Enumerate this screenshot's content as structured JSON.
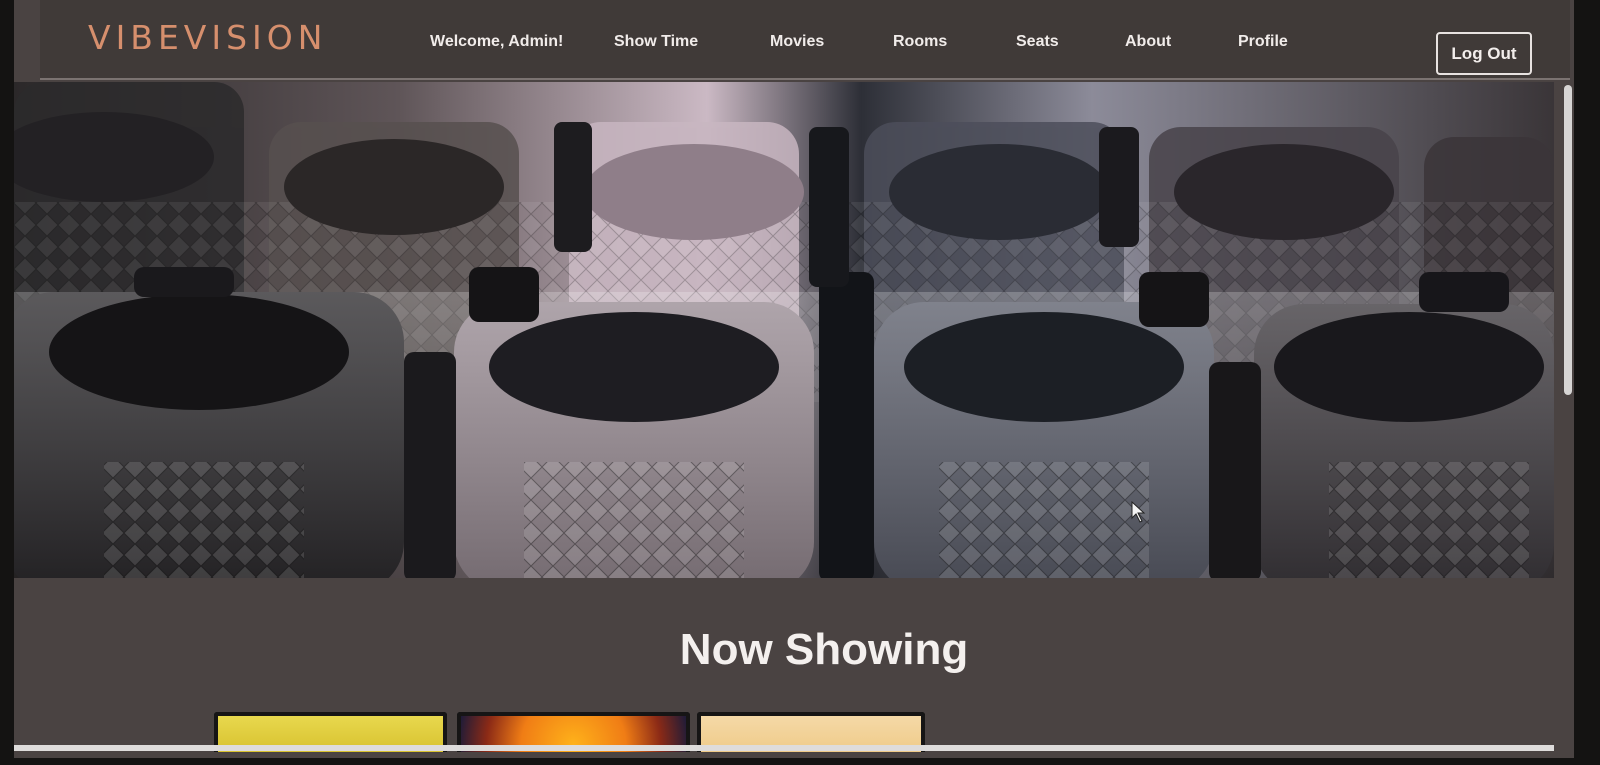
{
  "brand": "VIBEVISION",
  "nav": {
    "welcome": "Welcome, Admin!",
    "items": [
      "Show Time",
      "Movies",
      "Rooms",
      "Seats",
      "About",
      "Profile"
    ],
    "logout": "Log Out"
  },
  "hero": {
    "image": "cinema-seats-photo"
  },
  "section": {
    "title": "Now Showing"
  },
  "posters": [
    "poster-1",
    "poster-2",
    "poster-3"
  ],
  "colors": {
    "brand": "#d68f6d",
    "navbar": "#403a38",
    "page_background": "#4a4342",
    "text": "#f4f0ee"
  }
}
